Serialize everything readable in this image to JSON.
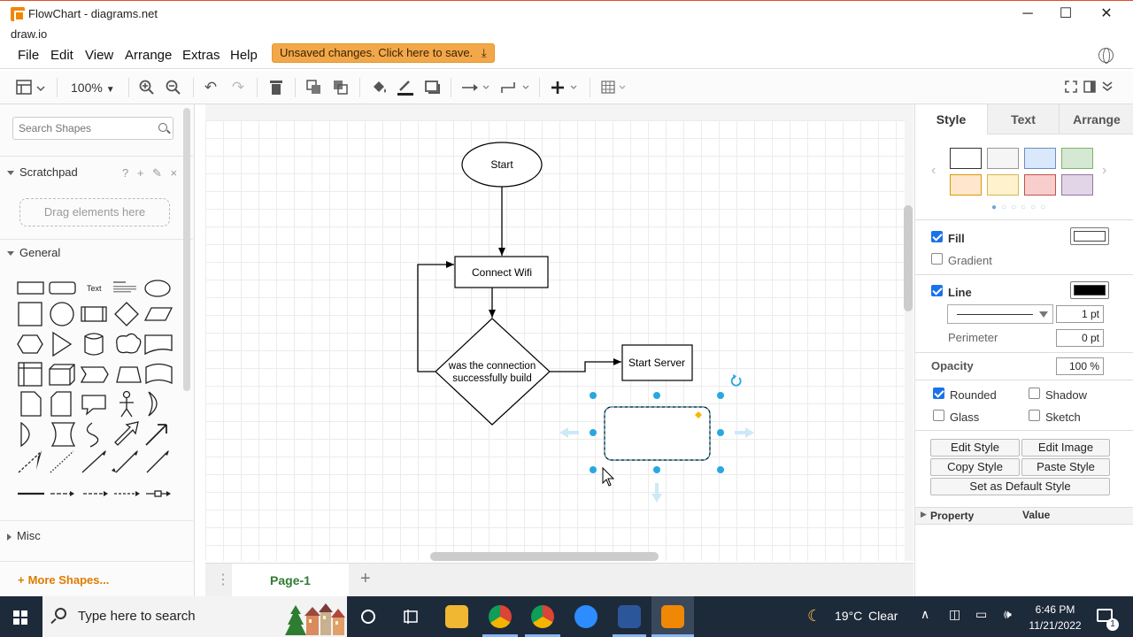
{
  "window": {
    "title": "FlowChart - diagrams.net",
    "subtitle": "draw.io",
    "minimize": "─",
    "maximize": "☐",
    "close": "✕"
  },
  "menu": {
    "items": [
      "File",
      "Edit",
      "View",
      "Arrange",
      "Extras",
      "Help"
    ],
    "unsaved_notice": "Unsaved changes. Click here to save."
  },
  "toolbar": {
    "zoom": "100%",
    "icons": [
      "view-menu-icon",
      "zoom-in-icon",
      "zoom-out-icon",
      "undo-icon",
      "redo-icon",
      "delete-icon",
      "to-front-icon",
      "to-back-icon",
      "fill-color-icon",
      "line-color-icon",
      "shadow-icon",
      "connection-icon",
      "waypoints-icon",
      "insert-icon",
      "table-icon",
      "fullscreen-icon",
      "format-panel-icon",
      "collapse-icon"
    ]
  },
  "left_panel": {
    "search_placeholder": "Search Shapes",
    "scratchpad": "Scratchpad",
    "scratchpad_tools": "? + ✎ ×",
    "dropzone": "Drag elements here",
    "general": "General",
    "misc": "Misc",
    "more_shapes": "More Shapes...",
    "text_shape": "Text"
  },
  "diagram": {
    "start": "Start",
    "connect_wifi": "Connect Wifi",
    "decision_line1": "was the connection",
    "decision_line2": "successfully build",
    "start_server": "Start Server"
  },
  "pages": {
    "current": "Page-1",
    "add": "+",
    "menu": "⋮"
  },
  "right_panel": {
    "tabs": [
      "Style",
      "Text",
      "Arrange"
    ],
    "active_tab": "Style",
    "swatches": [
      "#ffffff",
      "#f5f5f5",
      "#dae8fc",
      "#d5e8d4",
      "#ffe6cc",
      "#fff2cc",
      "#f8cecc",
      "#e1d5e7"
    ],
    "fill_label": "Fill",
    "fill_checked": true,
    "fill_color": "#ffffff",
    "gradient_label": "Gradient",
    "line_label": "Line",
    "line_checked": true,
    "line_color": "#000000",
    "line_width": "1 pt",
    "perimeter_label": "Perimeter",
    "perimeter_value": "0 pt",
    "opacity_label": "Opacity",
    "opacity_value": "100 %",
    "rounded_label": "Rounded",
    "shadow_label": "Shadow",
    "glass_label": "Glass",
    "sketch_label": "Sketch",
    "buttons": {
      "edit_style": "Edit Style",
      "edit_image": "Edit Image",
      "copy_style": "Copy Style",
      "paste_style": "Paste Style",
      "set_default": "Set as Default Style"
    },
    "property_header": "Property",
    "value_header": "Value"
  },
  "taskbar": {
    "search_placeholder": "Type here to search",
    "weather_temp": "19°C",
    "weather_desc": "Clear",
    "time": "6:46 PM",
    "date": "11/21/2022",
    "notification_count": "1"
  },
  "colors": {
    "accent_orange": "#f08705",
    "selection_blue": "#29a7e0",
    "unsaved_bg": "#f2a84a",
    "page_tab_green": "#2e7d32",
    "taskbar_bg": "#1d2a3a"
  }
}
